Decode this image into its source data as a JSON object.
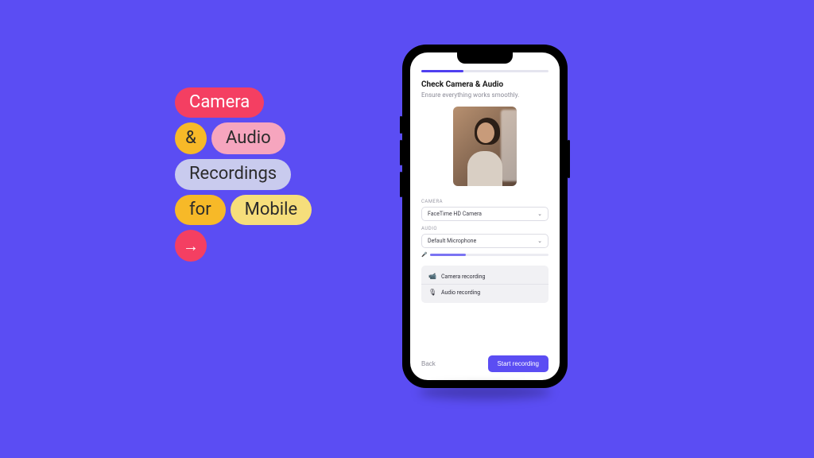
{
  "colors": {
    "bg": "#5b4df3",
    "pink": "#f43f62",
    "amber": "#f7b928",
    "rose": "#f6a5be",
    "lavender": "#c9cbee",
    "butter": "#f6de7b",
    "primary": "#5b4df3"
  },
  "heading": {
    "word1": "Camera",
    "amp": "&",
    "word2": "Audio",
    "word3": "Recordings",
    "word4": "for",
    "word5": "Mobile",
    "arrow_glyph": "→"
  },
  "screen": {
    "title": "Check Camera & Audio",
    "subtitle": "Ensure everything works smoothly.",
    "camera_label": "CAMERA",
    "camera_value": "FaceTime HD Camera",
    "audio_label": "AUDIO",
    "audio_value": "Default Microphone",
    "meter_icon": "🎤",
    "meter_level_pct": 30,
    "info1_icon": "📹",
    "info1_text": "Camera recording",
    "info2_icon": "🎙",
    "info2_text": "Audio recording",
    "back_label": "Back",
    "start_label": "Start recording",
    "chevron_glyph": "⌄"
  }
}
